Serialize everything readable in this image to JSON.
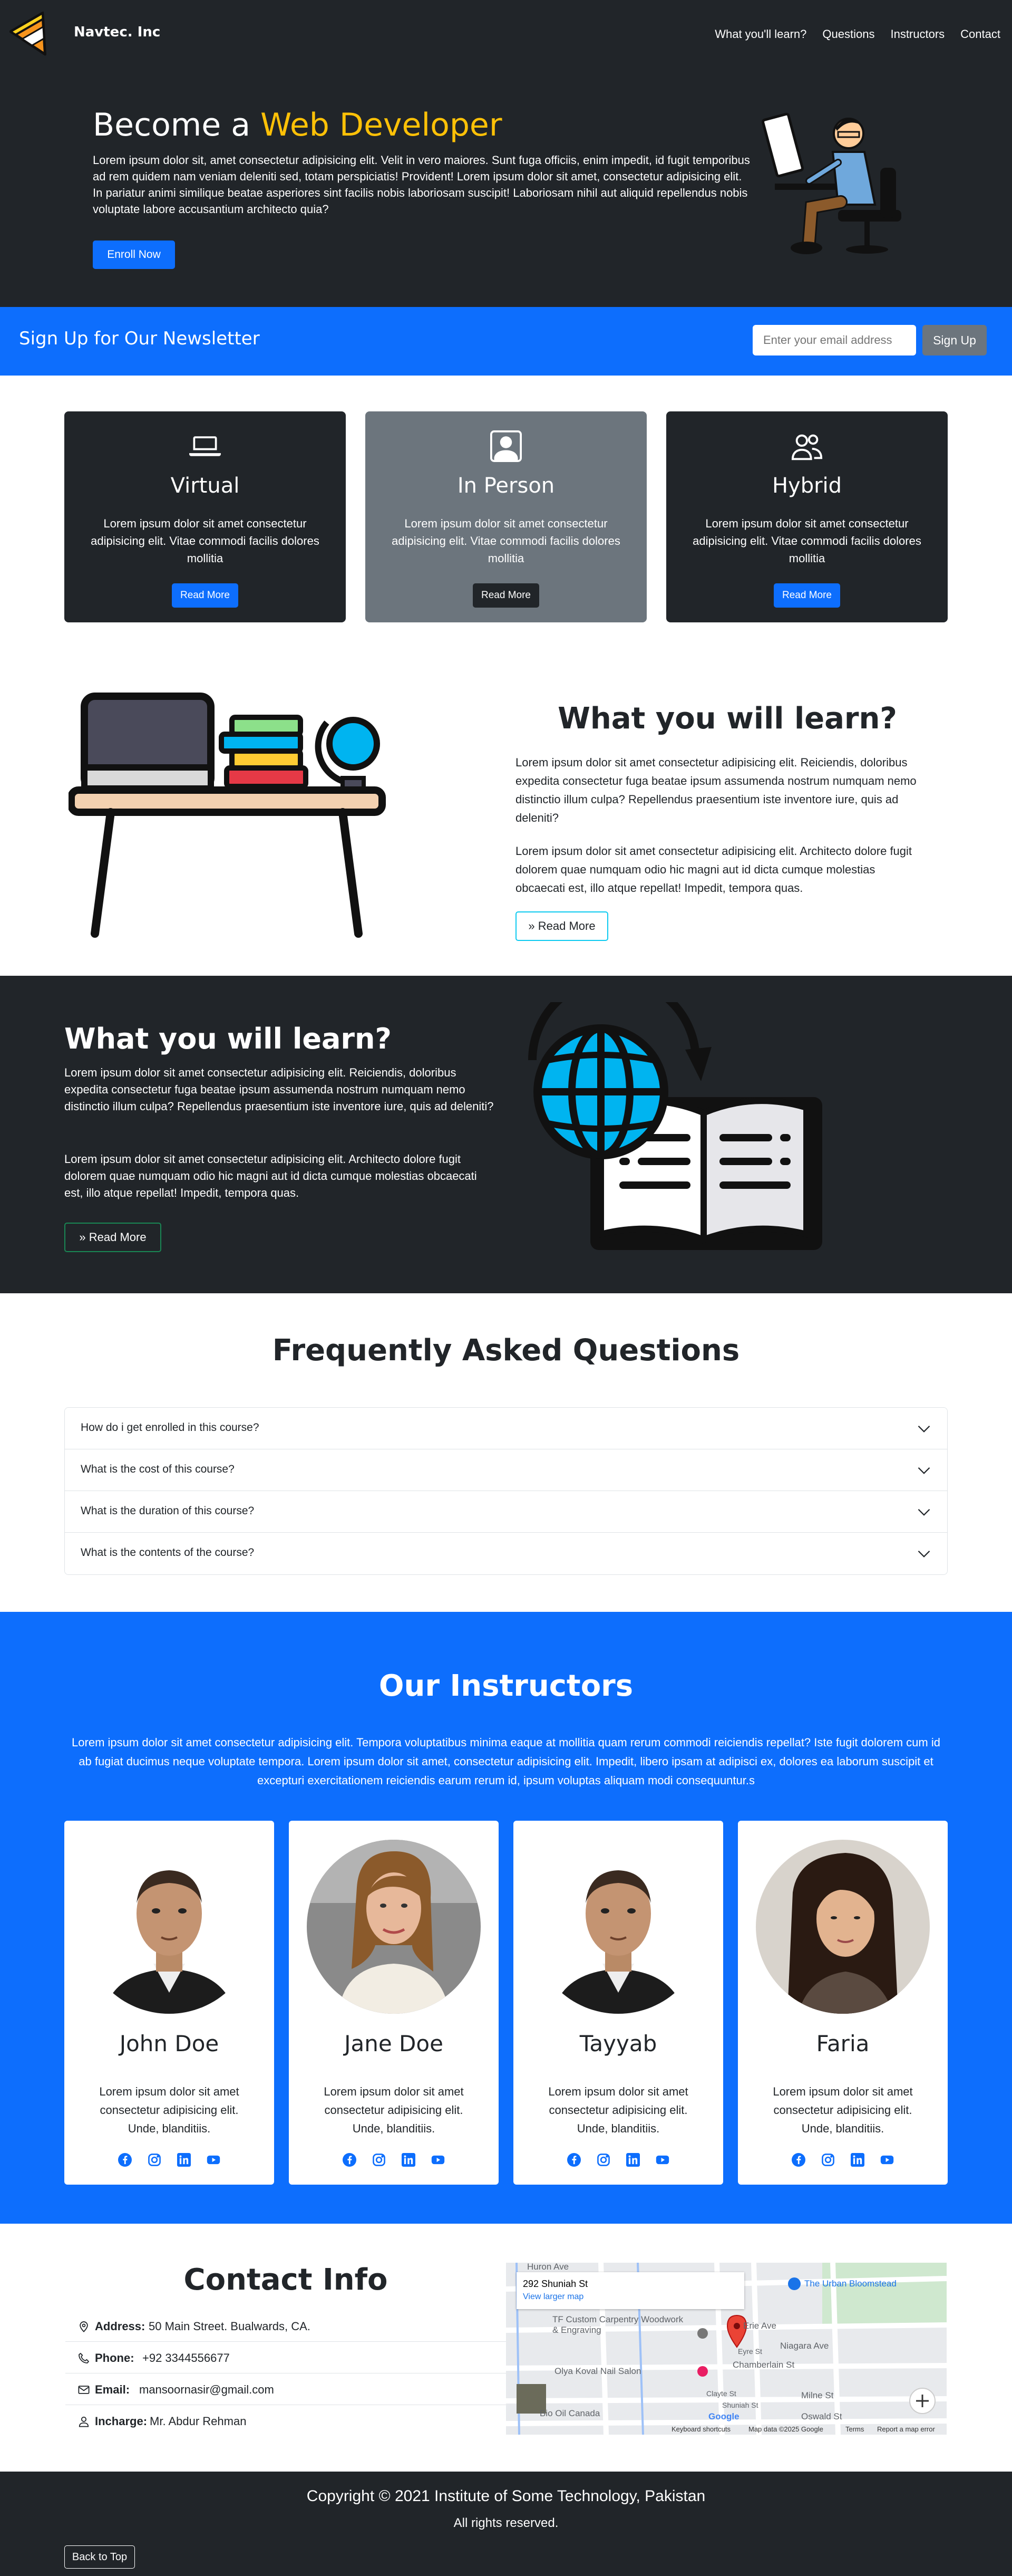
{
  "nav": {
    "brand": "Navtec. Inc",
    "links": [
      "What you'll learn?",
      "Questions",
      "Instructors",
      "Contact"
    ]
  },
  "hero": {
    "title_prefix": "Become a ",
    "title_accent": "Web Developer",
    "text": "Lorem ipsum dolor sit, amet consectetur adipisicing elit. Velit in vero maiores. Sunt fuga officiis, enim impedit, id fugit temporibus ad rem quidem nam veniam deleniti sed, totam perspiciatis! Provident! Lorem ipsum dolor sit amet, consectetur adipisicing elit. In pariatur animi similique beatae asperiores sint facilis nobis laboriosam suscipit! Laboriosam nihil aut aliquid repellendus nobis voluptate labore accusantium architecto quia?",
    "button": "Enroll Now",
    "accent_color": "#ffc107"
  },
  "newsletter": {
    "title": "Sign Up for Our Newsletter",
    "placeholder": "Enter your email address",
    "button": "Sign Up"
  },
  "boxes": [
    {
      "icon": "laptop-icon",
      "title": "Virtual",
      "text": "Lorem ipsum dolor sit amet consectetur adipisicing elit. Vitae commodi facilis dolores mollitia",
      "button": "Read More",
      "bg": "#212529",
      "button_color": "#0d6efd"
    },
    {
      "icon": "person-square-icon",
      "title": "In Person",
      "text": "Lorem ipsum dolor sit amet consectetur adipisicing elit. Vitae commodi facilis dolores mollitia",
      "button": "Read More",
      "bg": "#6c757d",
      "button_color": "#212529"
    },
    {
      "icon": "people-icon",
      "title": "Hybrid",
      "text": "Lorem ipsum dolor sit amet consectetur adipisicing elit. Vitae commodi facilis dolores mollitia",
      "button": "Read More",
      "bg": "#212529",
      "button_color": "#0d6efd"
    }
  ],
  "learn1": {
    "title": "What you will learn?",
    "p1": "Lorem ipsum dolor sit amet consectetur adipisicing elit. Reiciendis, doloribus expedita consectetur fuga beatae ipsum assumenda nostrum numquam nemo distinctio illum culpa? Repellendus praesentium iste inventore iure, quis ad deleniti?",
    "p2": "Lorem ipsum dolor sit amet consectetur adipisicing elit. Architecto dolore fugit dolorem quae numquam odio hic magni aut id dicta cumque molestias obcaecati est, illo atque repellat! Impedit, tempora quas.",
    "button": "Read More"
  },
  "learn2": {
    "title": "What you will learn?",
    "p1": "Lorem ipsum dolor sit amet consectetur adipisicing elit. Reiciendis, doloribus expedita consectetur fuga beatae ipsum assumenda nostrum numquam nemo distinctio illum culpa? Repellendus praesentium iste inventore iure, quis ad deleniti?",
    "p2": "Lorem ipsum dolor sit amet consectetur adipisicing elit. Architecto dolore fugit dolorem quae numquam odio hic magni aut id dicta cumque molestias obcaecati est, illo atque repellat! Impedit, tempora quas.",
    "button": "Read More"
  },
  "faq": {
    "title": "Frequently Asked Questions",
    "items": [
      "How do i get enrolled in this course?",
      "What is the cost of this course?",
      "What is the duration of this course?",
      "What is the contents of the course?"
    ]
  },
  "instructors": {
    "title": "Our Instructors",
    "text": "Lorem ipsum dolor sit amet consectetur adipisicing elit. Tempora voluptatibus minima eaque at mollitia quam rerum commodi reiciendis repellat? Iste fugit dolorem cum id ab fugiat ducimus neque voluptate tempora. Lorem ipsum dolor sit amet, consectetur adipisicing elit. Impedit, libero ipsam at adipisci ex, dolores ea laborum suscipit et excepturi exercitationem reiciendis earum rerum id, ipsum voluptas aliquam modi consequuntur.s",
    "cards": [
      {
        "name": "John Doe",
        "text": "Lorem ipsum dolor sit amet consectetur adipisicing elit. Unde, blanditiis."
      },
      {
        "name": "Jane Doe",
        "text": "Lorem ipsum dolor sit amet consectetur adipisicing elit. Unde, blanditiis."
      },
      {
        "name": "Tayyab",
        "text": "Lorem ipsum dolor sit amet consectetur adipisicing elit. Unde, blanditiis."
      },
      {
        "name": "Faria",
        "text": "Lorem ipsum dolor sit amet consectetur adipisicing elit. Unde, blanditiis."
      }
    ],
    "social_icons": [
      "facebook-icon",
      "instagram-icon",
      "linkedin-icon",
      "youtube-icon"
    ]
  },
  "contact": {
    "title": "Contact Info",
    "rows": [
      {
        "icon": "geo-icon",
        "label": "Address:",
        "value": "50 Main Street. Bualwards, CA."
      },
      {
        "icon": "phone-icon",
        "label": "Phone:",
        "value": "+92 3344556677"
      },
      {
        "icon": "envelope-icon",
        "label": "Email:",
        "value": "mansoornasir@gmail.com"
      },
      {
        "icon": "person-icon",
        "label": "Incharge:",
        "value": "Mr. Abdur Rehman"
      }
    ],
    "map": {
      "address": "292 Shuniah St",
      "link": "View larger map",
      "labels": [
        "Huron Ave",
        "The Urban Bloomstead",
        "TF Custom Carpentry Woodwork & Engraving",
        "Erie Ave",
        "Niagara Ave",
        "Chamberlain St",
        "Olya Koval Nail Salon",
        "Milne St",
        "Oswald St",
        "Clayte St",
        "Eyre St",
        "Shuniah St",
        "Bio Oil Canada"
      ],
      "footer": [
        "Keyboard shortcuts",
        "Map data ©2025 Google",
        "Terms",
        "Report a map error"
      ],
      "logo": "Google"
    }
  },
  "footer": {
    "copyright": "Copyright © 2021 Institute of Some Technology, Pakistan",
    "rights": "All rights reserved.",
    "back_to_top": "Back to Top"
  }
}
